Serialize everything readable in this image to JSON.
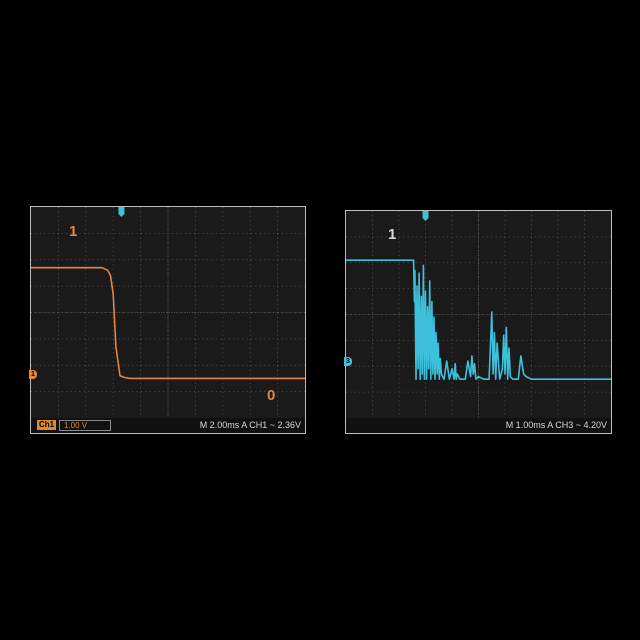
{
  "colors": {
    "orange": "#e4843e",
    "cyan": "#3cc0dc",
    "grid": "#5e5e5e",
    "screen": "#1a1a1a"
  },
  "left": {
    "status": {
      "channel": "Ch1",
      "vdiv": "1.00 V",
      "readout": "M 2.00ms  A  CH1  ~  2.36V"
    },
    "labels": {
      "high": "1",
      "low": "0"
    },
    "markers": {
      "trigger": "T",
      "channel": "1"
    }
  },
  "right": {
    "status": {
      "readout": "M 1.00ms  A  CH3  ~  4.20V"
    },
    "labels": {
      "high": "1"
    },
    "markers": {
      "trigger": "T",
      "channel": "3"
    }
  },
  "chart_data": [
    {
      "type": "line",
      "series": [
        {
          "color": "#e4843e",
          "x": [
            0,
            2.6,
            2.8,
            2.9,
            3.0,
            3.1,
            3.25,
            3.4,
            3.6,
            10
          ],
          "y": [
            2.1,
            2.1,
            2.05,
            1.95,
            1.6,
            0.6,
            0.05,
            0.02,
            0.0,
            0.0
          ]
        }
      ],
      "xlim": [
        0,
        10
      ],
      "ylim": [
        -0.75,
        3.25
      ],
      "grid": true
    },
    {
      "type": "line",
      "series": [
        {
          "color": "#3cc0dc",
          "x": [
            0,
            2.55,
            2.58,
            2.6,
            2.64,
            2.68,
            2.72,
            2.76,
            2.8,
            2.84,
            2.88,
            2.92,
            2.96,
            3.0,
            3.04,
            3.08,
            3.12,
            3.16,
            3.2,
            3.24,
            3.28,
            3.32,
            3.36,
            3.4,
            3.44,
            3.48,
            3.52,
            3.56,
            3.6,
            3.7,
            3.8,
            3.9,
            4.0,
            4.08,
            4.12,
            4.16,
            4.2,
            4.3,
            4.5,
            4.6,
            4.7,
            4.75,
            4.8,
            4.85,
            4.9,
            5.0,
            5.2,
            5.4,
            5.5,
            5.55,
            5.6,
            5.65,
            5.7,
            5.8,
            5.9,
            5.95,
            6.0,
            6.05,
            6.1,
            6.15,
            6.2,
            6.3,
            6.5,
            6.6,
            6.7,
            6.8,
            7.0,
            10
          ],
          "y": [
            2.3,
            2.3,
            1.5,
            2.1,
            0.0,
            1.8,
            0.2,
            2.05,
            0.0,
            1.6,
            0.1,
            2.2,
            0.0,
            1.7,
            0.0,
            1.4,
            0.2,
            1.9,
            0.0,
            1.5,
            0.1,
            1.2,
            0.0,
            0.9,
            0.1,
            0.7,
            0.0,
            0.4,
            0.1,
            0.0,
            0.35,
            0.0,
            0.2,
            0.0,
            0.3,
            0.0,
            0.1,
            0.0,
            0.0,
            0.35,
            0.05,
            0.45,
            0.1,
            0.3,
            0.0,
            0.05,
            0.0,
            0.0,
            1.3,
            0.1,
            0.9,
            0.0,
            0.7,
            0.0,
            0.2,
            0.85,
            0.1,
            1.0,
            0.0,
            0.6,
            0.05,
            0.0,
            0.0,
            0.45,
            0.1,
            0.05,
            0.0,
            0.0
          ]
        }
      ],
      "xlim": [
        0,
        10
      ],
      "ylim": [
        -0.75,
        3.25
      ],
      "grid": true
    }
  ]
}
